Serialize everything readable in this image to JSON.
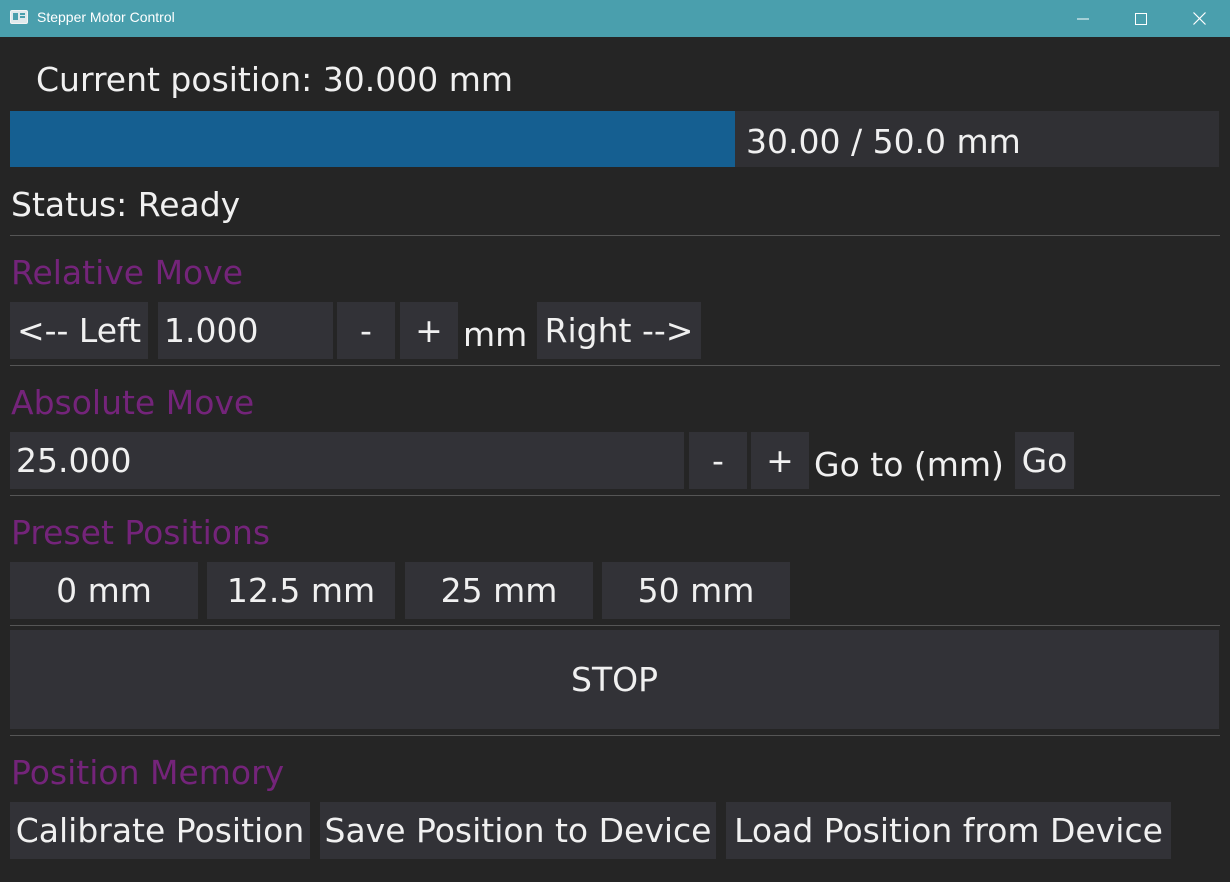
{
  "window": {
    "title": "Stepper Motor Control"
  },
  "position": {
    "label": "Current position: 30.000 mm",
    "progress_text": "30.00 / 50.0 mm",
    "current_mm": 30.0,
    "max_mm": 50.0
  },
  "status": {
    "text": "Status: Ready"
  },
  "relative_move": {
    "title": "Relative Move",
    "left_label": "<-- Left",
    "step_value": "1.000",
    "minus_label": "-",
    "plus_label": "+",
    "unit_label": "mm",
    "right_label": "Right -->"
  },
  "absolute_move": {
    "title": "Absolute Move",
    "target_value": "25.000",
    "minus_label": "-",
    "plus_label": "+",
    "goto_label": "Go to (mm)",
    "go_label": "Go"
  },
  "presets": {
    "title": "Preset Positions",
    "items": [
      "0 mm",
      "12.5 mm",
      "25 mm",
      "50 mm"
    ]
  },
  "stop": {
    "label": "STOP"
  },
  "memory": {
    "title": "Position Memory",
    "calibrate_label": "Calibrate Position",
    "save_label": "Save Position to Device",
    "load_label": "Load Position from Device"
  },
  "colors": {
    "titlebar": "#4a9fad",
    "background": "#252525",
    "button": "#323237",
    "progress_fill": "#155f91",
    "section_title": "#74247a"
  }
}
